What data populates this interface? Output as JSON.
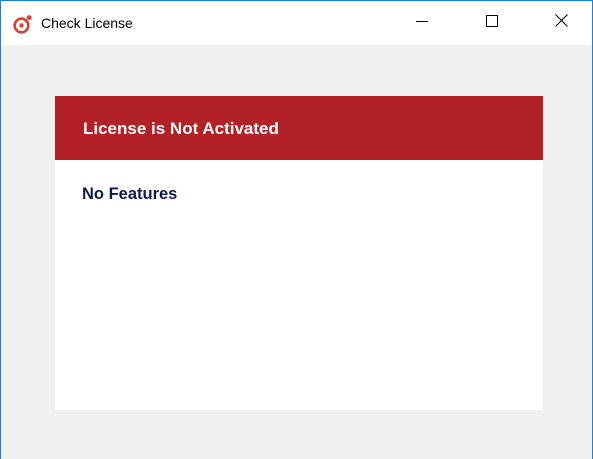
{
  "window": {
    "title": "Check License",
    "icon": "app-logo-icon",
    "controls": {
      "minimize_icon": "minimize-icon",
      "maximize_icon": "maximize-icon",
      "close_icon": "close-icon"
    }
  },
  "license": {
    "status_text": "License is Not Activated",
    "features_text": "No Features"
  },
  "colors": {
    "banner": "#b12126",
    "features_text": "#0e1a4c",
    "window_border": "#1883d7",
    "window_background": "#f0f0f0",
    "panel_background": "#ffffff"
  }
}
